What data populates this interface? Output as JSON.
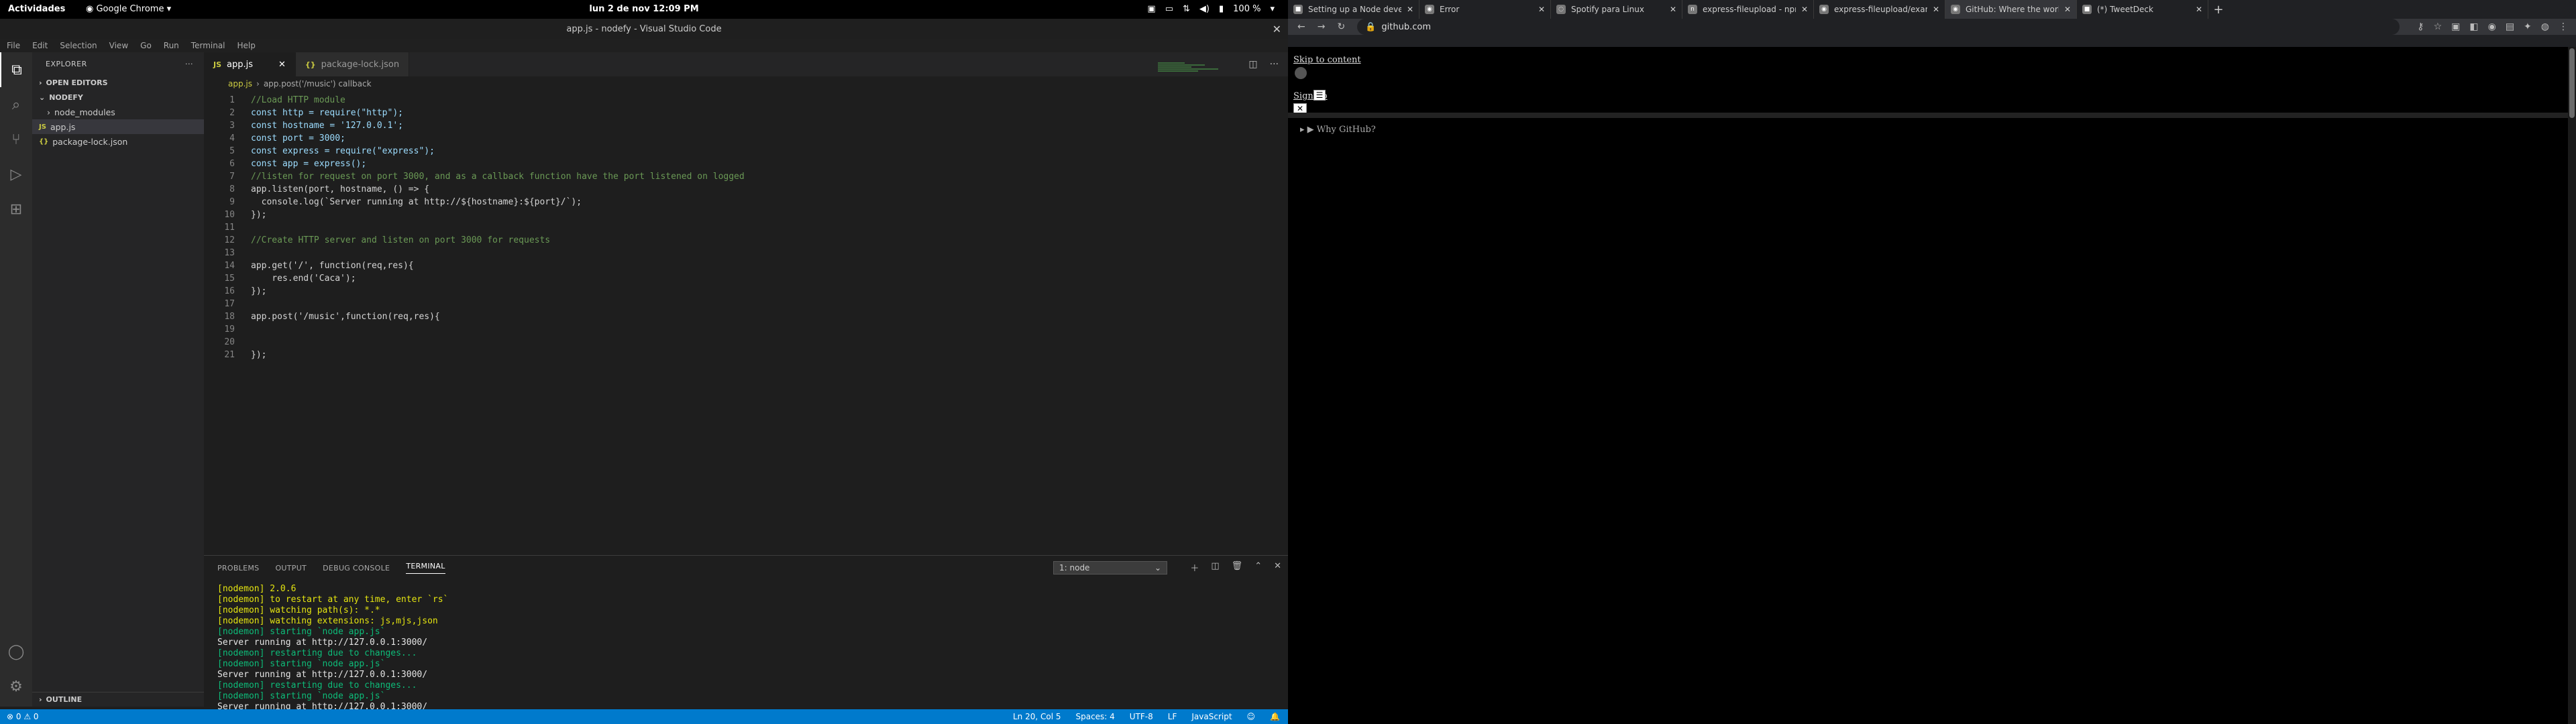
{
  "gnome": {
    "activities": "Actividades",
    "app": "Google Chrome",
    "clock": "lun 2 de nov  12:09 PM",
    "battery": "100 %"
  },
  "vscode": {
    "title": "app.js - nodefy - Visual Studio Code",
    "menu": [
      "File",
      "Edit",
      "Selection",
      "View",
      "Go",
      "Run",
      "Terminal",
      "Help"
    ],
    "explorer_label": "EXPLORER",
    "open_editors": "OPEN EDITORS",
    "project": "NODEFY",
    "tree": [
      {
        "name": "node_modules",
        "type": "folder"
      },
      {
        "name": "app.js",
        "type": "js"
      },
      {
        "name": "package-lock.json",
        "type": "json"
      }
    ],
    "outline": "OUTLINE",
    "tabs": [
      {
        "label": "app.js",
        "type": "JS"
      },
      {
        "label": "package-lock.json",
        "type": "{}"
      }
    ],
    "breadcrumb": [
      "app.js",
      "app.post('/music') callback"
    ],
    "code": [
      "//Load HTTP module",
      "const http = require(\"http\");",
      "const hostname = '127.0.0.1';",
      "const port = 3000;",
      "const express = require(\"express\");",
      "const app = express();",
      "//listen for request on port 3000, and as a callback function have the port listened on logged",
      "app.listen(port, hostname, () => {",
      "  console.log(`Server running at http://${hostname}:${port}/`);",
      "});",
      "",
      "//Create HTTP server and listen on port 3000 for requests",
      "",
      "app.get('/', function(req,res){",
      "    res.end('Caca');",
      "});",
      "",
      "app.post('/music',function(req,res){",
      "",
      "",
      "});"
    ],
    "panel_tabs": [
      "PROBLEMS",
      "OUTPUT",
      "DEBUG CONSOLE",
      "TERMINAL"
    ],
    "terminal_select": "1: node",
    "terminal": [
      {
        "t": "[nodemon] 2.0.6",
        "c": "y"
      },
      {
        "t": "[nodemon] to restart at any time, enter `rs`",
        "c": "y"
      },
      {
        "t": "[nodemon] watching path(s): *.*",
        "c": "y"
      },
      {
        "t": "[nodemon] watching extensions: js,mjs,json",
        "c": "y"
      },
      {
        "t": "[nodemon] starting `node app.js`",
        "c": "g"
      },
      {
        "t": "Server running at http://127.0.0.1:3000/",
        "c": "w"
      },
      {
        "t": "[nodemon] restarting due to changes...",
        "c": "g"
      },
      {
        "t": "[nodemon] starting `node app.js`",
        "c": "g"
      },
      {
        "t": "Server running at http://127.0.0.1:3000/",
        "c": "w"
      },
      {
        "t": "[nodemon] restarting due to changes...",
        "c": "g"
      },
      {
        "t": "[nodemon] starting `node app.js`",
        "c": "g"
      },
      {
        "t": "Server running at http://127.0.0.1:3000/",
        "c": "w"
      },
      {
        "t": "▯",
        "c": "w"
      }
    ],
    "status_left": "⊗ 0  ⚠ 0",
    "status_right": [
      "Ln 20, Col 5",
      "Spaces: 4",
      "UTF-8",
      "LF",
      "JavaScript"
    ]
  },
  "chrome": {
    "tabs": [
      {
        "title": "Setting up a Node developm",
        "icon": "■"
      },
      {
        "title": "Error",
        "icon": "◉"
      },
      {
        "title": "Spotify para Linux",
        "icon": "◌"
      },
      {
        "title": "express-fileupload - npm",
        "icon": "n"
      },
      {
        "title": "express-fileupload/exampl",
        "icon": "◉"
      },
      {
        "title": "GitHub: Where the world bu",
        "icon": "◉",
        "active": true
      },
      {
        "title": "(*) TweetDeck",
        "icon": "■"
      }
    ],
    "url": "github.com",
    "page": {
      "skip": "Skip to content",
      "signup": "Sign up",
      "why": "Why GitHub?"
    }
  }
}
